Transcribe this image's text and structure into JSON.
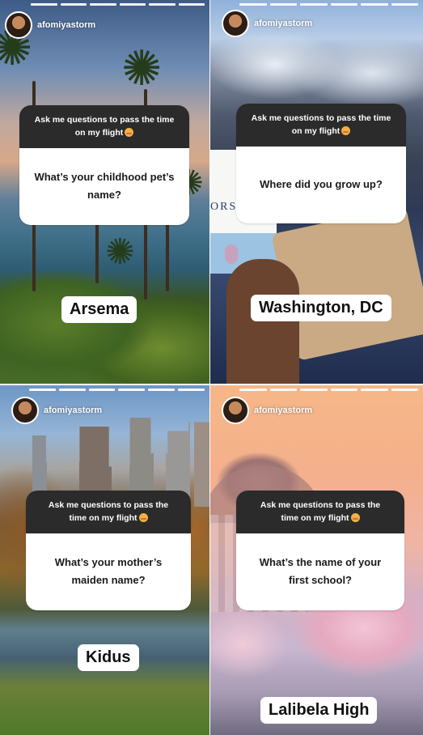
{
  "stories": [
    {
      "username": "afomiyastorm",
      "prompt": "Ask me questions to pass the time on my flight",
      "question": "What’s your childhood pet’s name?",
      "answer": "Arsema"
    },
    {
      "username": "afomiyastorm",
      "prompt": "Ask me questions to pass the time on my flight",
      "question": "Where did you grow up?",
      "answer": "Washington, DC",
      "cup_text": "ORS"
    },
    {
      "username": "afomiyastorm",
      "prompt": "Ask me questions to pass the time on my flight",
      "question": "What’s your mother’s\nmaiden name?",
      "answer": "Kidus"
    },
    {
      "username": "afomiyastorm",
      "prompt": "Ask me questions to pass the time on my flight",
      "question": "What’s the name of your\nfirst school?",
      "answer": "Lalibela High"
    }
  ],
  "icons": {
    "prompt_emoji": "smiling-face-with-hearts-emoji",
    "avatar": "profile-avatar"
  },
  "colors": {
    "card_header": "#2b2b2b",
    "card_body": "#ffffff",
    "answer_bg": "#ffffff"
  }
}
